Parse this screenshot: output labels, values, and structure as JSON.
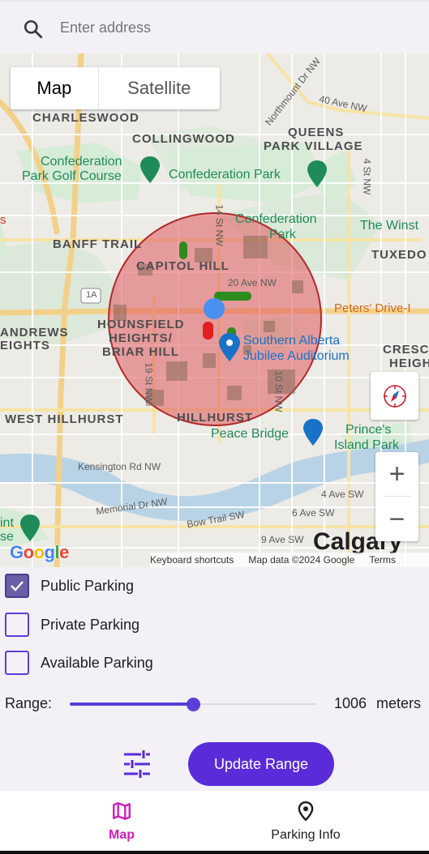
{
  "search": {
    "placeholder": "Enter address",
    "icon": "search-icon"
  },
  "map": {
    "type_toggle": {
      "map_label": "Map",
      "satellite_label": "Satellite",
      "selected": "Map"
    },
    "labels": {
      "charleswood": "CHARLESWOOD",
      "collingwood": "COLLINGWOOD",
      "queens_park_1": "QUEENS",
      "queens_park_2": "PARK VILLAGE",
      "confed_golf_1": "Confederation",
      "confed_golf_2": "Park Golf Course",
      "confed_park": "Confederation Park",
      "confed_park2_1": "Confederation",
      "confed_park2_2": "Park",
      "the_winston": "The Winst",
      "banff_trail": "BANFF TRAIL",
      "tuxedo": "TUXEDO",
      "capitol_hill": "CAPITOL HILL",
      "ave20": "20 Ave NW",
      "peters_drive_in": "Peters' Drive-I",
      "andrews_1": "ANDREWS",
      "andrews_2": "EIGHTS",
      "hounsfield_1": "HOUNSFIELD",
      "hounsfield_2": "HEIGHTS/",
      "hounsfield_3": "BRIAR HILL",
      "southern_alberta_1": "Southern Alberta",
      "southern_alberta_2": "Jubilee Auditorium",
      "crescent_1": "CRESC",
      "crescent_2": "HEIGH",
      "west_hillhurst": "WEST HILLHURST",
      "hillhurst": "HILLHURST",
      "peace_bridge": "Peace Bridge",
      "princes_1": "Prince's",
      "princes_2": "Island Park",
      "kensington": "Kensington Rd NW",
      "memorial": "Memorial Dr NW",
      "bow_trail": "Bow Trail SW",
      "ave4sw": "4 Ave SW",
      "ave6sw": "6 Ave SW",
      "ave9sw": "9 Ave SW",
      "calgary": "Calgary",
      "ave40": "40 Ave NW",
      "northmount": "Northmount Dr NW",
      "st4": "4 St NW",
      "st14": "14 St NW",
      "st19": "19 St NW",
      "st10": "10 St NW",
      "hwy1a": "1A",
      "left_edge": "s",
      "int_1": "int",
      "int_2": "se"
    },
    "range_circle_color": "#e0585c",
    "user_location_color": "#4a8ff2",
    "parking_colors": {
      "public": "#2e8b1e",
      "private": "#e02020"
    },
    "google_logo": "Google",
    "attribution": {
      "shortcuts": "Keyboard shortcuts",
      "data": "Map data ©2024 Google",
      "terms": "Terms"
    },
    "controls": {
      "compass_icon": "compass-icon",
      "zoom_in": "+",
      "zoom_out": "−"
    }
  },
  "filters": [
    {
      "label": "Public Parking",
      "checked": true
    },
    {
      "label": "Private Parking",
      "checked": false
    },
    {
      "label": "Available Parking",
      "checked": false
    }
  ],
  "range": {
    "label": "Range:",
    "value": "1006",
    "unit": "meters",
    "slider_fraction": 0.5
  },
  "actions": {
    "filter_icon": "tune-icon",
    "update_label": "Update Range"
  },
  "nav": {
    "map_label": "Map",
    "info_label": "Parking Info",
    "active": "Map",
    "active_color": "#d01eb8"
  },
  "colors": {
    "accent": "#5a2bd8",
    "checkbox_fill": "#6a5fa4"
  }
}
